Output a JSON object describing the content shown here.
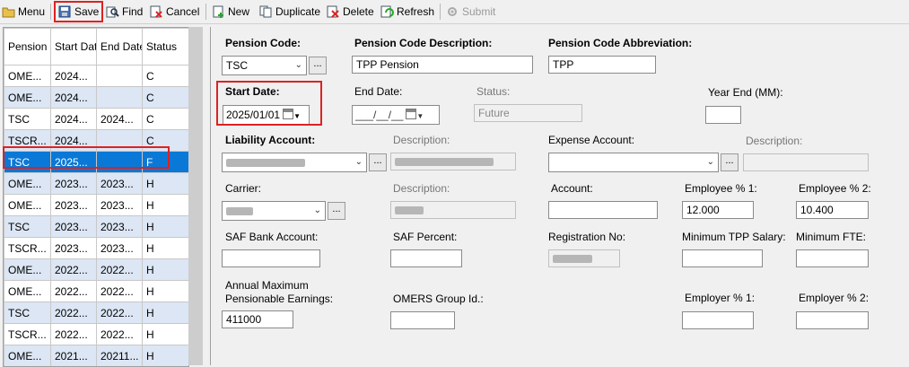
{
  "toolbar": {
    "menu": "Menu",
    "save": "Save",
    "find": "Find",
    "cancel": "Cancel",
    "new": "New",
    "duplicate": "Duplicate",
    "delete": "Delete",
    "refresh": "Refresh",
    "submit": "Submit"
  },
  "grid": {
    "headers": [
      "Pension Code",
      "Start Date",
      "End Date",
      "Status"
    ],
    "rows": [
      [
        "OME...",
        "2024...",
        "",
        "C"
      ],
      [
        "OME...",
        "2024...",
        "",
        "C"
      ],
      [
        "TSC",
        "2024...",
        "2024...",
        "C"
      ],
      [
        "TSCR...",
        "2024...",
        "",
        "C"
      ],
      [
        "TSC",
        "2025...",
        "",
        "F"
      ],
      [
        "OME...",
        "2023...",
        "2023...",
        "H"
      ],
      [
        "OME...",
        "2023...",
        "2023...",
        "H"
      ],
      [
        "TSC",
        "2023...",
        "2023...",
        "H"
      ],
      [
        "TSCR...",
        "2023...",
        "2023...",
        "H"
      ],
      [
        "OME...",
        "2022...",
        "2022...",
        "H"
      ],
      [
        "OME...",
        "2022...",
        "2022...",
        "H"
      ],
      [
        "TSC",
        "2022...",
        "2022...",
        "H"
      ],
      [
        "TSCR...",
        "2022...",
        "2022...",
        "H"
      ],
      [
        "OME...",
        "2021...",
        "20211...",
        "H"
      ]
    ]
  },
  "form": {
    "pension_code_label": "Pension Code:",
    "pension_code_value": "TSC",
    "description_label": "Pension Code Description:",
    "description_value": "TPP Pension",
    "abbreviation_label": "Pension Code Abbreviation:",
    "abbreviation_value": "TPP",
    "start_date_label": "Start Date:",
    "start_date_value": "2025/01/01",
    "end_date_label": "End Date:",
    "end_date_value": "___/__/__",
    "status_label": "Status:",
    "status_value": "Future",
    "year_end_label": "Year End (MM):",
    "liability_label": "Liability Account:",
    "desc_label": "Description:",
    "expense_label": "Expense Account:",
    "carrier_label": "Carrier:",
    "account_label": "Account:",
    "employee1_label": "Employee % 1:",
    "employee1_value": "12.000",
    "employee2_label": "Employee % 2:",
    "employee2_value": "10.400",
    "saf_bank_label": "SAF Bank Account:",
    "saf_percent_label": "SAF Percent:",
    "registration_label": "Registration No:",
    "min_salary_label": "Minimum TPP Salary:",
    "min_fte_label": "Minimum FTE:",
    "ympe_label_1": "Annual Maximum",
    "ympe_label_2": "Pensionable Earnings:",
    "ympe_value": "411000",
    "omers_label": "OMERS Group Id.:",
    "employer1_label": "Employer % 1:",
    "employer2_label": "Employer % 2:"
  }
}
